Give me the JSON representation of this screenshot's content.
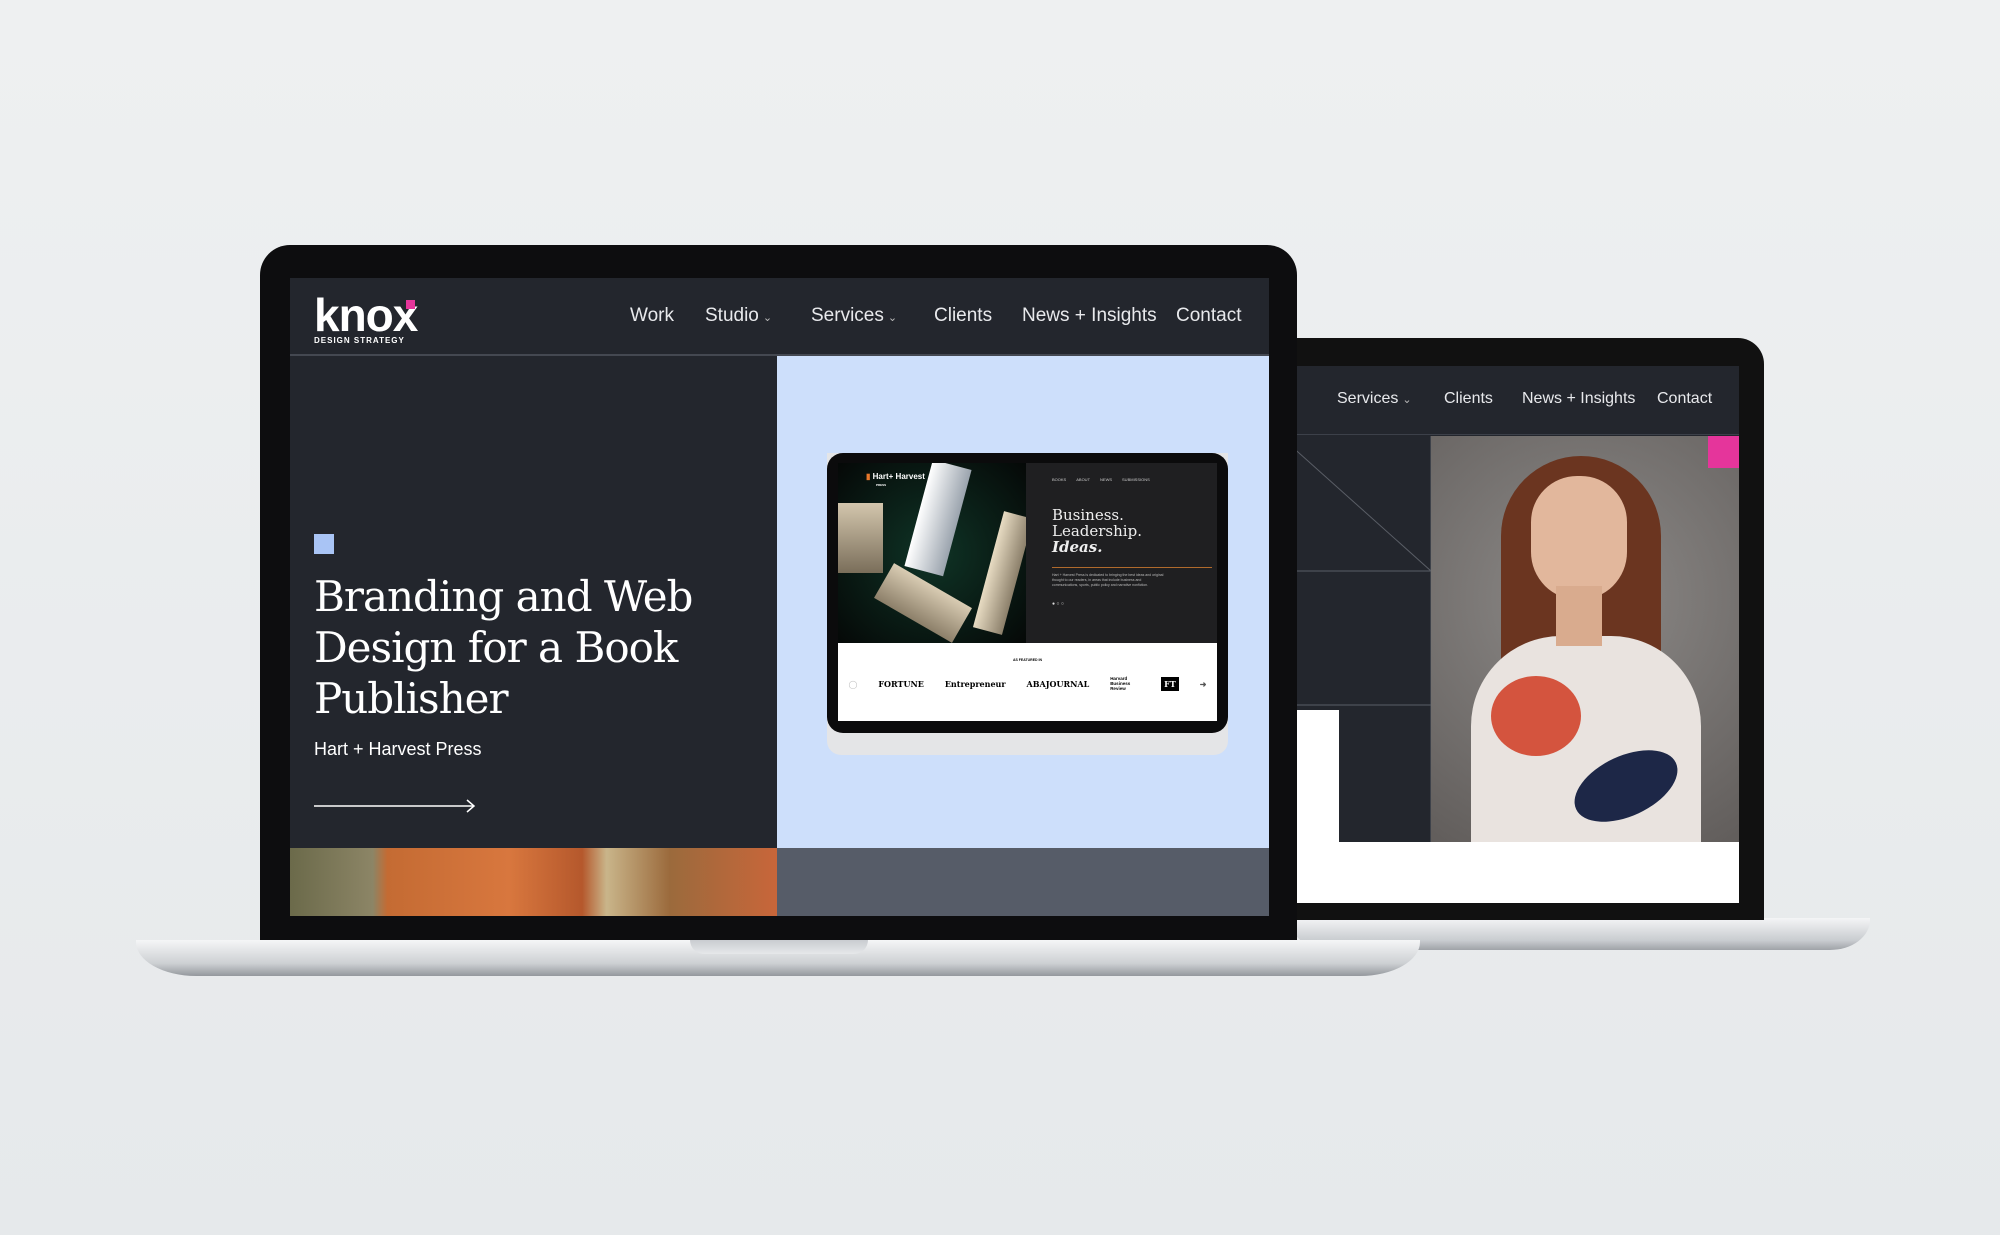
{
  "back_site": {
    "nav": [
      {
        "label": "Services",
        "dropdown": true
      },
      {
        "label": "Clients"
      },
      {
        "label": "News + Insights"
      },
      {
        "label": "Contact"
      }
    ],
    "accent": "#e5359b"
  },
  "front_site": {
    "logo": {
      "word": "knox",
      "tagline": "DESIGN STRATEGY",
      "accent": "#e5359b"
    },
    "nav": [
      {
        "label": "Work"
      },
      {
        "label": "Studio",
        "dropdown": true
      },
      {
        "label": "Services",
        "dropdown": true
      },
      {
        "label": "Clients"
      },
      {
        "label": "News + Insights"
      },
      {
        "label": "Contact"
      }
    ],
    "hero": {
      "title_lines": [
        "Branding and Web",
        "Design for a Book",
        "Publisher"
      ],
      "client": "Hart + Harvest Press",
      "accent": "#a9c4f5",
      "panel_color": "#cddffb"
    },
    "tablet": {
      "logo": "Hart+ Harvest",
      "logo_sub": "PRESS",
      "nav": [
        "BOOKS",
        "ABOUT",
        "NEWS",
        "SUBMISSIONS"
      ],
      "headline": [
        "Business.",
        "Leadership.",
        "Ideas."
      ],
      "body": "Hart + Harvest Press is dedicated to bringing the best ideas and original thought to our readers, in areas that include business and communications, sports, public policy and narrative nonfiction.",
      "featured_label": "AS FEATURED IN",
      "logos": [
        "FORTUNE",
        "Entrepreneur",
        "ABAJOURNAL",
        "Harvard Business Review",
        "FT"
      ]
    }
  }
}
